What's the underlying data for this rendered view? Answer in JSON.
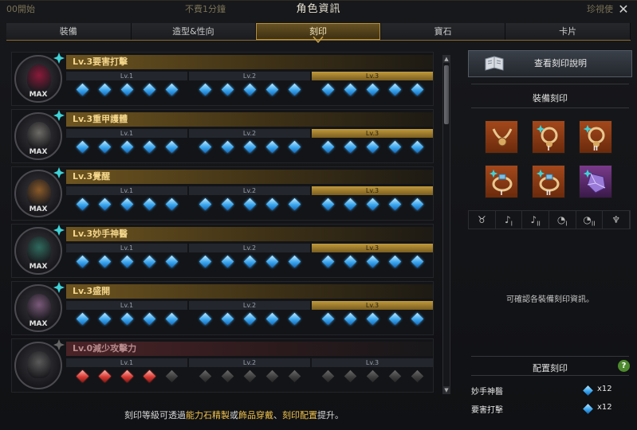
{
  "window": {
    "title": "角色資訊",
    "close": "✕"
  },
  "background": {
    "left_text": "00開始",
    "mid_text": "不費1分鐘",
    "right_text": "珍視使"
  },
  "tabs": [
    "裝備",
    "造型&性向",
    "刻印",
    "寶石",
    "卡片"
  ],
  "active_tab": "刻印",
  "engravings": [
    {
      "title": "Lv.3要害打擊",
      "badge": "MAX",
      "active": true,
      "level_labels": [
        "Lv.1",
        "Lv.2",
        "Lv.3"
      ],
      "gem_color": "blue",
      "gems_per_level": 5,
      "art_color": "#8a1a3a"
    },
    {
      "title": "Lv.3重甲護體",
      "badge": "MAX",
      "active": true,
      "level_labels": [
        "Lv.1",
        "Lv.2",
        "Lv.3"
      ],
      "gem_color": "blue",
      "gems_per_level": 5,
      "art_color": "#6d6b66"
    },
    {
      "title": "Lv.3覺醒",
      "badge": "MAX",
      "active": true,
      "level_labels": [
        "Lv.1",
        "Lv.2",
        "Lv.3"
      ],
      "gem_color": "blue",
      "gems_per_level": 5,
      "art_color": "#8a5a2a"
    },
    {
      "title": "Lv.3妙手神醫",
      "badge": "MAX",
      "active": true,
      "level_labels": [
        "Lv.1",
        "Lv.2",
        "Lv.3"
      ],
      "gem_color": "blue",
      "gems_per_level": 5,
      "art_color": "#2f6a5e"
    },
    {
      "title": "Lv.3盛開",
      "badge": "MAX",
      "active": true,
      "level_labels": [
        "Lv.1",
        "Lv.2",
        "Lv.3"
      ],
      "gem_color": "blue",
      "gems_per_level": 5,
      "art_color": "#7a5a7a"
    },
    {
      "title": "Lv.0減少攻擊力",
      "badge": "",
      "active": false,
      "level_labels": [
        "Lv.1",
        "Lv.2",
        "Lv.3"
      ],
      "gem_color": "red",
      "gems_per_level": 5,
      "art_color": "#5a5a5a"
    }
  ],
  "footnote": {
    "prefix": "刻印等級可透過",
    "hl1": "能力石精製",
    "mid1": "或",
    "hl2": "飾品穿戴",
    "mid2": "、",
    "hl3": "刻印配置",
    "suffix": "提升。"
  },
  "right_panel": {
    "guide_button": "查看刻印說明",
    "equip_title": "裝備刻印",
    "slots": [
      {
        "name": "necklace",
        "roman": ""
      },
      {
        "name": "earring-1",
        "roman": "I"
      },
      {
        "name": "earring-2",
        "roman": "II"
      },
      {
        "name": "ring-1",
        "roman": "I"
      },
      {
        "name": "ring-2",
        "roman": "II"
      },
      {
        "name": "ability-stone",
        "roman": ""
      }
    ],
    "filters": [
      {
        "icon": "necklace-icon",
        "sub": ""
      },
      {
        "icon": "earring-icon",
        "sub": "I"
      },
      {
        "icon": "earring-icon",
        "sub": "II"
      },
      {
        "icon": "ring-icon",
        "sub": "I"
      },
      {
        "icon": "ring-icon",
        "sub": "II"
      },
      {
        "icon": "stone-icon",
        "sub": ""
      }
    ],
    "info_text": "可確認各裝備刻印資訊。",
    "config_title": "配置刻印",
    "help": "?",
    "configured": [
      {
        "name": "妙手神醫",
        "count": "x12"
      },
      {
        "name": "要害打擊",
        "count": "x12"
      }
    ]
  },
  "colors": {
    "accent_gold": "#c09a3c",
    "gem_blue": "#3aa6ef",
    "gem_red": "#d93b34",
    "slot_orange": "#a4481c",
    "cross_teal": "#3fd3d8"
  }
}
